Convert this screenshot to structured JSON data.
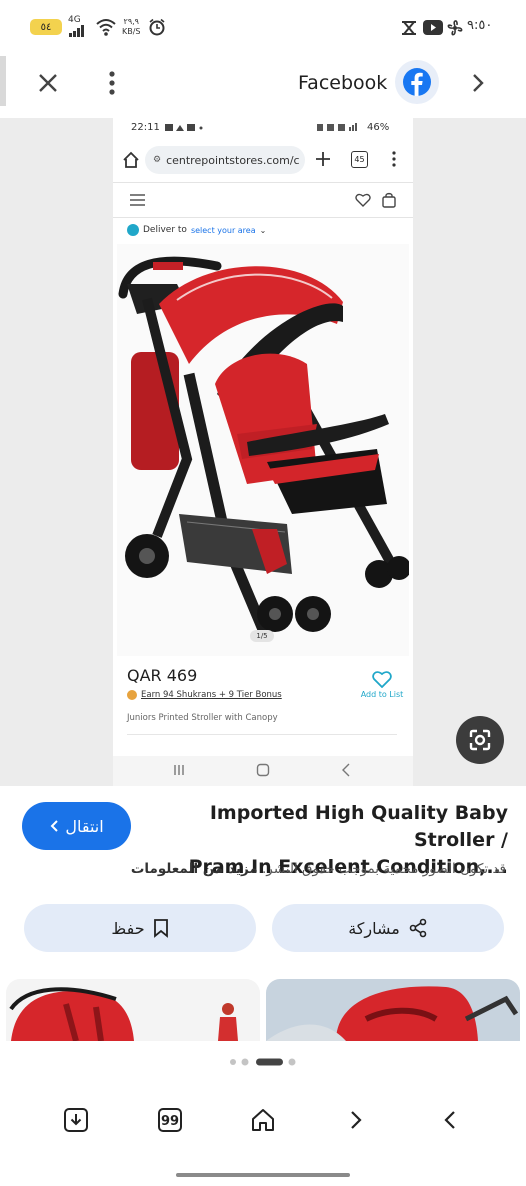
{
  "status_bar": {
    "time": "٩:٥٠",
    "battery": "٥٤",
    "network": "4G",
    "speed_value": "٢٩,٩",
    "speed_unit": "KB/S"
  },
  "header": {
    "source_name": "Facebook"
  },
  "inner_screenshot": {
    "time": "22:11",
    "battery": "46%",
    "url": "centrepointstores.com/c",
    "tab_count": "45",
    "deliver_label": "Deliver to",
    "deliver_link": "select your area",
    "image_counter": "1/5",
    "price": "QAR 469",
    "shukrans": "Earn 94 Shukrans + 9  Tier Bonus",
    "add_to_list": "Add to List",
    "product_name": "Juniors Printed Stroller with Canopy"
  },
  "result": {
    "title_line1": "Imported High Quality Baby Stroller /",
    "title_line2": "Pram In Excelent Condition,...",
    "visit_label": "انتقال",
    "copyright_notice": "قد تكون الصور محمية بموجب حقوق النشر.",
    "learn_more": "مزيد من المعلومات",
    "share_label": "مشاركة",
    "save_label": "حفظ"
  },
  "colors": {
    "accent": "#1a73e8",
    "pill_bg": "#e3ebf8",
    "stroller_red": "#d6262b"
  },
  "bottom_nav": {
    "icons": [
      "download-icon",
      "quote-icon",
      "home-icon",
      "forward-icon",
      "back-icon"
    ]
  }
}
